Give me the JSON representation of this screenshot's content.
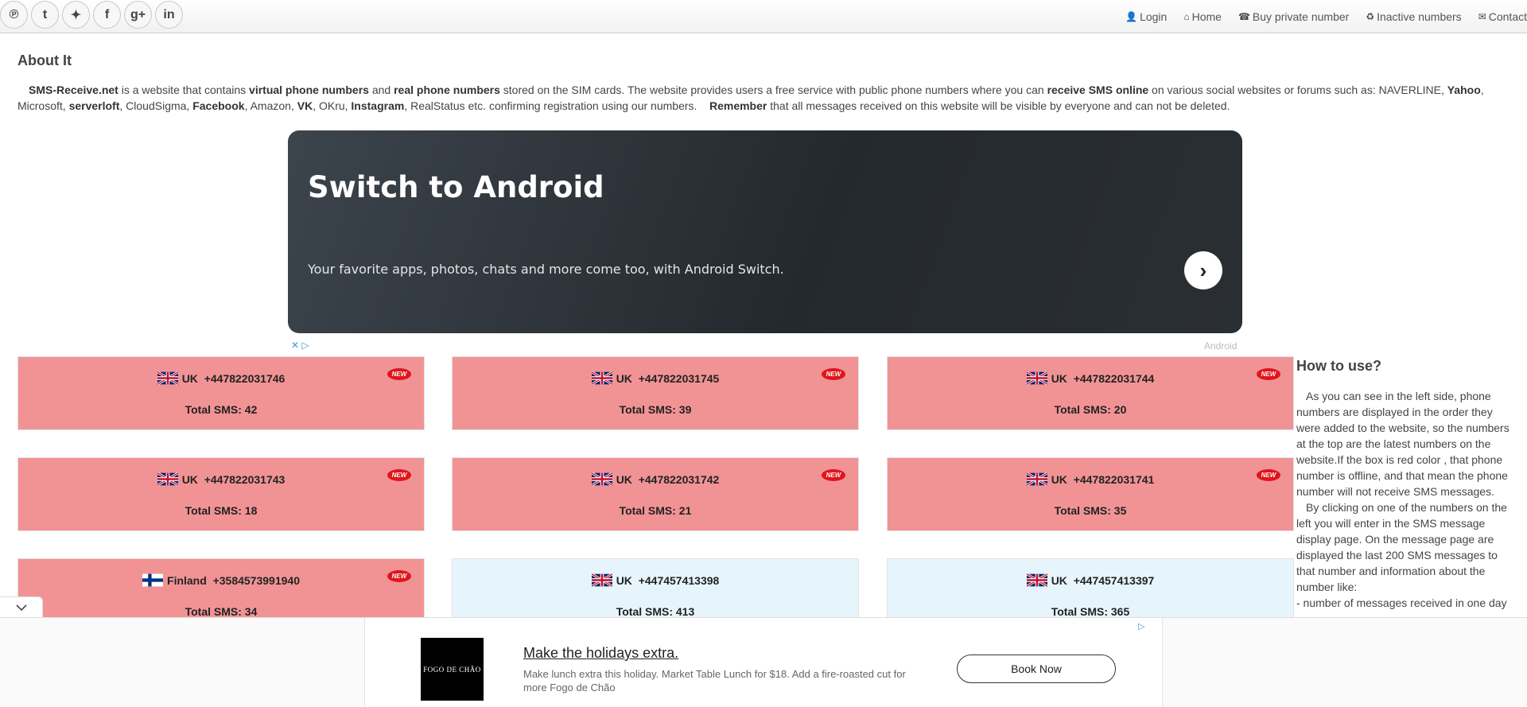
{
  "social": [
    {
      "name": "pinterest-icon",
      "glyph": "℗"
    },
    {
      "name": "tumblr-icon",
      "glyph": "t"
    },
    {
      "name": "twitter-icon",
      "glyph": "✦"
    },
    {
      "name": "facebook-icon",
      "glyph": "f"
    },
    {
      "name": "googleplus-icon",
      "glyph": "g+"
    },
    {
      "name": "linkedin-icon",
      "glyph": "in"
    }
  ],
  "nav": [
    {
      "name": "nav-login",
      "icon": "user-icon",
      "glyph": "👤",
      "label": "Login"
    },
    {
      "name": "nav-home",
      "icon": "home-icon",
      "glyph": "⌂",
      "label": "Home"
    },
    {
      "name": "nav-buy-private-number",
      "icon": "phone-icon",
      "glyph": "☎",
      "label": "Buy private number"
    },
    {
      "name": "nav-inactive-numbers",
      "icon": "recycle-icon",
      "glyph": "♻",
      "label": "Inactive numbers"
    },
    {
      "name": "nav-contact",
      "icon": "envelope-icon",
      "glyph": "✉",
      "label": "Contact"
    }
  ],
  "about": {
    "title": "About It",
    "p1": "SMS-Receive.net",
    "p2": " is a website that contains ",
    "p3": "virtual phone numbers",
    "p4": " and ",
    "p5": "real phone numbers",
    "p6": " stored on the SIM cards. The website provides users a free service with public phone numbers where you can ",
    "p7": "receive SMS online",
    "p8": " on various social websites or forums such as: NAVERLINE, ",
    "p9": "Yahoo",
    "p10": ", Microsoft, ",
    "p11": "serverloft",
    "p12": ", CloudSigma, ",
    "p13": "Facebook",
    "p14": ", Amazon, ",
    "p15": "VK",
    "p16": ", OKru, ",
    "p17": "Instagram",
    "p18": ", RealStatus etc. confirming registration using our numbers.    ",
    "p19": "Remember",
    "p20": " that all messages received on this website will be visible by everyone and can not be deleted."
  },
  "ad": {
    "title": "Switch to Android",
    "subtitle": "Your favorite apps, photos, chats and more come too, with Android Switch.",
    "brand": "Android",
    "choices": "✕ ▷"
  },
  "numbers": [
    {
      "country": "UK",
      "flag": "uk",
      "number": "+447822031746",
      "sms": "Total SMS: 42",
      "status": "offline",
      "new": true
    },
    {
      "country": "UK",
      "flag": "uk",
      "number": "+447822031745",
      "sms": "Total SMS: 39",
      "status": "offline",
      "new": true
    },
    {
      "country": "UK",
      "flag": "uk",
      "number": "+447822031744",
      "sms": "Total SMS: 20",
      "status": "offline",
      "new": true
    },
    {
      "country": "UK",
      "flag": "uk",
      "number": "+447822031743",
      "sms": "Total SMS: 18",
      "status": "offline",
      "new": true
    },
    {
      "country": "UK",
      "flag": "uk",
      "number": "+447822031742",
      "sms": "Total SMS: 21",
      "status": "offline",
      "new": true
    },
    {
      "country": "UK",
      "flag": "uk",
      "number": "+447822031741",
      "sms": "Total SMS: 35",
      "status": "offline",
      "new": true
    },
    {
      "country": "Finland",
      "flag": "fi",
      "number": "+3584573991940",
      "sms": "Total SMS: 34",
      "status": "offline",
      "new": true
    },
    {
      "country": "UK",
      "flag": "uk",
      "number": "+447457413398",
      "sms": "Total SMS: 413",
      "status": "online",
      "new": false
    },
    {
      "country": "UK",
      "flag": "uk",
      "number": "+447457413397",
      "sms": "Total SMS: 365",
      "status": "online",
      "new": false
    }
  ],
  "new_badge": "NEW",
  "howto": {
    "title": "How to use?",
    "p1": "As you can see in the left side, phone numbers are displayed in the order they were added to the website, so the numbers at the top are the latest numbers on the website.If the box is red color , that phone number is offline, and that mean the phone number will not receive SMS messages.",
    "p2": "By clicking on one of the numbers on the left you will enter in the SMS message display page. On the message page are displayed the last 200 SMS messages to that number and information about the number like:",
    "p3": "- number of messages received in one day (from when it was added the number"
  },
  "bottom_ad": {
    "logo": "FOGO DE CHÃO",
    "title": "Make the holidays extra.",
    "desc": "Make lunch extra this holiday. Market Table Lunch for $18. Add a fire-roasted cut for more Fogo de Chão",
    "button": "Book Now",
    "choices": "▷"
  },
  "colors": {
    "offline": "#f19394",
    "online": "#e6f5fc",
    "ad_bg": "#2c3238"
  }
}
